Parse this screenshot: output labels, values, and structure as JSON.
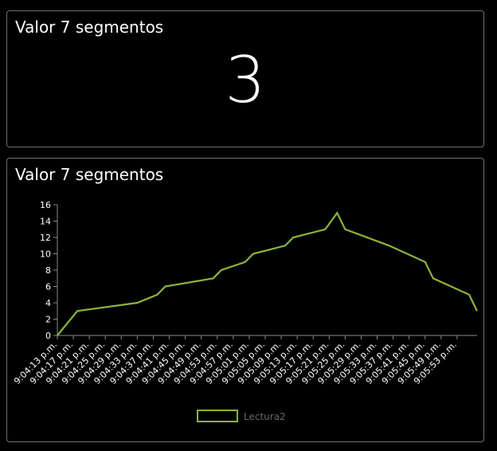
{
  "value_card": {
    "title": "Valor 7 segmentos",
    "value": "3"
  },
  "chart_card": {
    "title": "Valor 7 segmentos"
  },
  "colors": {
    "background": "#000000",
    "card_border": "#6f6f6f",
    "series_line": "#8cb43c",
    "text": "#ffffff",
    "legend_text": "#666666"
  },
  "chart_data": {
    "type": "line",
    "title": "",
    "xlabel": "",
    "ylabel": "",
    "ylim": [
      0,
      16
    ],
    "y_ticks": [
      0,
      2,
      4,
      6,
      8,
      10,
      12,
      14,
      16
    ],
    "x_tick_labels": [
      "9:04:13 p.m.",
      "9:04:17 p.m.",
      "9:04:21 p.m.",
      "9:04:25 p.m.",
      "9:04:29 p.m.",
      "9:04:33 p.m.",
      "9:04:37 p.m.",
      "9:04:41 p.m.",
      "9:04:45 p.m.",
      "9:04:49 p.m.",
      "9:04:53 p.m.",
      "9:04:57 p.m.",
      "9:05:01 p.m.",
      "9:05:05 p.m.",
      "9:05:09 p.m.",
      "9:05:13 p.m.",
      "9:05:17 p.m.",
      "9:05:21 p.m.",
      "9:05:25 p.m.",
      "9:05:29 p.m.",
      "9:05:33 p.m.",
      "9:05:37 p.m.",
      "9:05:41 p.m.",
      "9:05:45 p.m.",
      "9:05:49 p.m.",
      "9:05:53 p.m."
    ],
    "x_range": [
      "9:04:13 p.m.",
      "9:05:58 p.m."
    ],
    "legend_position": "bottom-center",
    "grid": false,
    "series": [
      {
        "name": "Lectura2",
        "points": [
          {
            "x": "9:04:13 p.m.",
            "y": 0
          },
          {
            "x": "9:04:18 p.m.",
            "y": 3
          },
          {
            "x": "9:04:33 p.m.",
            "y": 4
          },
          {
            "x": "9:04:38 p.m.",
            "y": 5
          },
          {
            "x": "9:04:40 p.m.",
            "y": 6
          },
          {
            "x": "9:04:52 p.m.",
            "y": 7
          },
          {
            "x": "9:04:54 p.m.",
            "y": 8
          },
          {
            "x": "9:05:00 p.m.",
            "y": 9
          },
          {
            "x": "9:05:02 p.m.",
            "y": 10
          },
          {
            "x": "9:05:10 p.m.",
            "y": 11
          },
          {
            "x": "9:05:12 p.m.",
            "y": 12
          },
          {
            "x": "9:05:20 p.m.",
            "y": 13
          },
          {
            "x": "9:05:23 p.m.",
            "y": 15
          },
          {
            "x": "9:05:25 p.m.",
            "y": 13
          },
          {
            "x": "9:05:36 p.m.",
            "y": 11
          },
          {
            "x": "9:05:45 p.m.",
            "y": 9
          },
          {
            "x": "9:05:47 p.m.",
            "y": 7
          },
          {
            "x": "9:05:56 p.m.",
            "y": 5
          },
          {
            "x": "9:05:58 p.m.",
            "y": 3
          }
        ]
      }
    ]
  }
}
